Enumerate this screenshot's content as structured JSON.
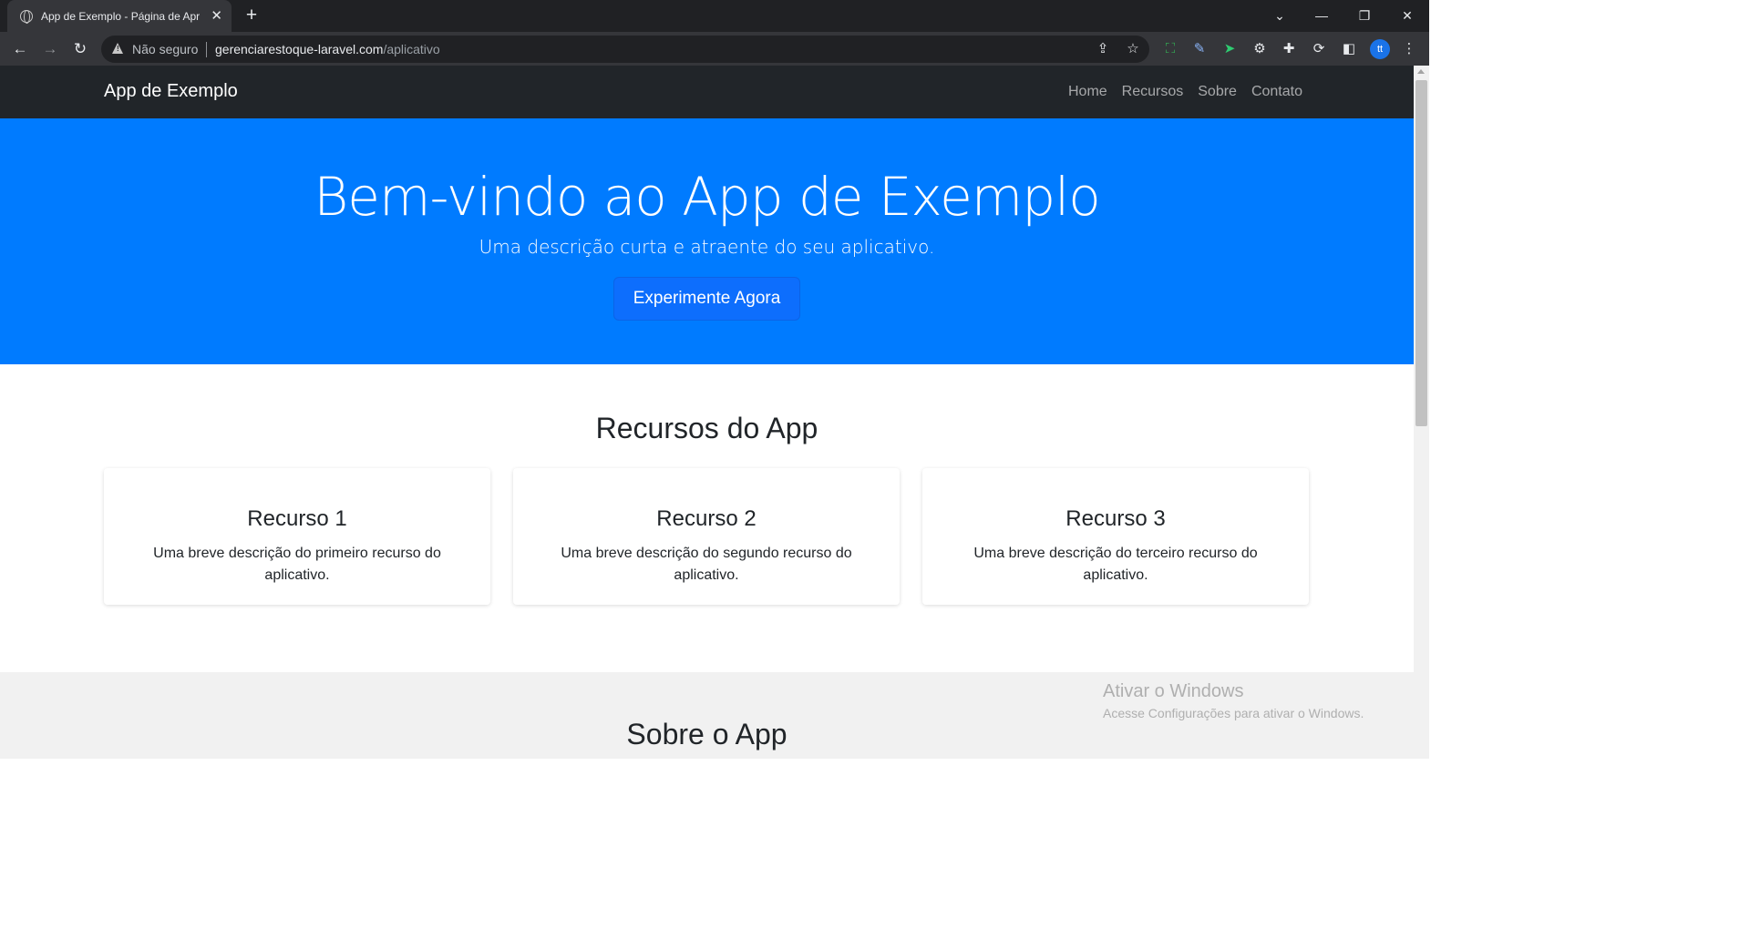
{
  "browser": {
    "tab_title": "App de Exemplo - Página de Apr",
    "new_tab_symbol": "+",
    "security_label": "Não seguro",
    "url_host": "gerenciarestoque-laravel.com",
    "url_path": "/aplicativo",
    "profile_initials": "tt"
  },
  "nav": {
    "brand": "App de Exemplo",
    "links": [
      "Home",
      "Recursos",
      "Sobre",
      "Contato"
    ]
  },
  "hero": {
    "title": "Bem-vindo ao App de Exemplo",
    "subtitle": "Uma descrição curta e atraente do seu aplicativo.",
    "cta": "Experimente Agora",
    "background": "#007bff"
  },
  "features": {
    "heading": "Recursos do App",
    "cards": [
      {
        "title": "Recurso 1",
        "text": "Uma breve descrição do primeiro recurso do aplicativo."
      },
      {
        "title": "Recurso 2",
        "text": "Uma breve descrição do segundo recurso do aplicativo."
      },
      {
        "title": "Recurso 3",
        "text": "Uma breve descrição do terceiro recurso do aplicativo."
      }
    ]
  },
  "about": {
    "heading": "Sobre o App"
  },
  "watermark": {
    "line1": "Ativar o Windows",
    "line2": "Acesse Configurações para ativar o Windows."
  }
}
